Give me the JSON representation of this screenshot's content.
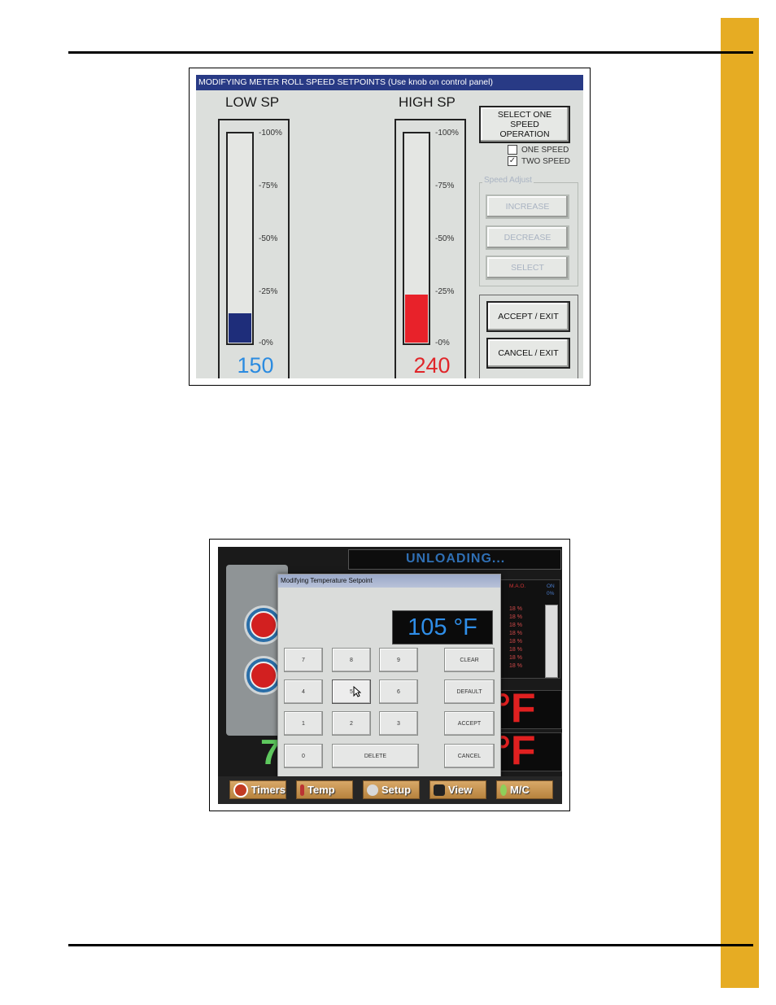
{
  "figure1": {
    "title": "MODIFYING METER ROLL SPEED SETPOINTS (Use knob on control panel)",
    "low": {
      "label": "LOW SP",
      "value": "150",
      "fill_fraction": 0.14,
      "color": "#1e2d7a",
      "value_color": "#2b8be0"
    },
    "high": {
      "label": "HIGH SP",
      "value": "240",
      "fill_fraction": 0.23,
      "color": "#e8222a",
      "value_color": "#e0262a"
    },
    "ticks": [
      "-100%",
      "-75%",
      "-50%",
      "-25%",
      "-0%"
    ],
    "select_button": "SELECT ONE SPEED OPERATION",
    "one_speed": {
      "label": "ONE SPEED",
      "checked": ""
    },
    "two_speed": {
      "label": "TWO SPEED",
      "checked": "✓"
    },
    "speed_adjust_legend": "Speed Adjust",
    "increase": "INCREASE",
    "decrease": "DECREASE",
    "select": "SELECT",
    "accept": "ACCEPT / EXIT",
    "cancel": "CANCEL / EXIT"
  },
  "figure2": {
    "status": "UNLOADING...",
    "dialog_title": "Modifying Temperature Setpoint",
    "display_value": "105 °F",
    "keys": {
      "k7": "7",
      "k8": "8",
      "k9": "9",
      "k4": "4",
      "k5": "5",
      "k6": "6",
      "k1": "1",
      "k2": "2",
      "k3": "3",
      "k0": "0",
      "delete": "DELETE",
      "clear": "CLEAR",
      "default": "DEFAULT",
      "accept": "ACCEPT",
      "cancel": "CANCEL"
    },
    "panel_heads": [
      "M.A.O.",
      "ON"
    ],
    "panel_sub": "0%",
    "panel_values": [
      "18 %",
      "18 %",
      "18 %",
      "18 %",
      "18 %",
      "18 %",
      "18 %",
      "18 %"
    ],
    "bg_temp_1": "°F",
    "bg_temp_2": "°F",
    "bg_green": "7",
    "taskbar": [
      "Timers",
      "Temp",
      "Setup",
      "View",
      "M/C"
    ]
  }
}
